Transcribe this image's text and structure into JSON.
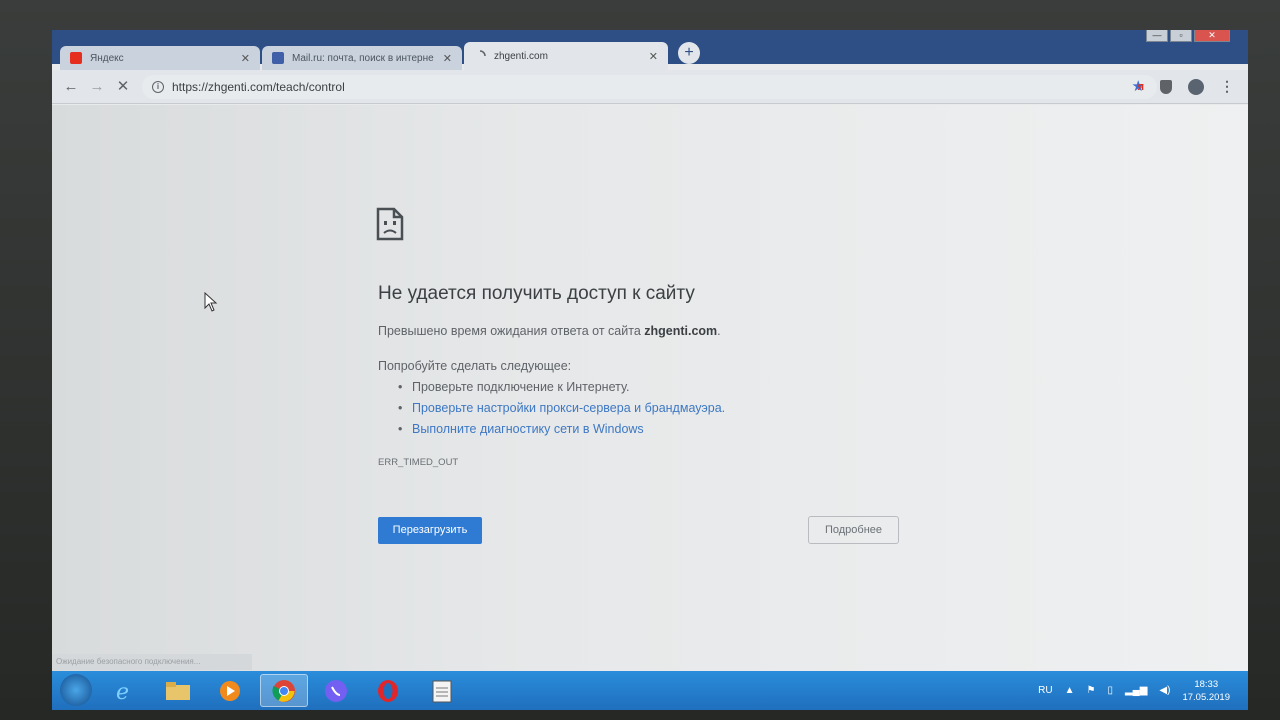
{
  "tabs": [
    {
      "title": "Яндекс",
      "favicon_color": "#e52e1e",
      "close": "✕"
    },
    {
      "title": "Mail.ru: почта, поиск в интерне",
      "favicon_color": "#3f5fa8",
      "close": "✕"
    },
    {
      "title": "zhgenti.com",
      "favicon_icon": "loading-spinner-icon",
      "close": "✕"
    }
  ],
  "new_tab": "+",
  "window_controls": {
    "minimize": "—",
    "maximize": "▫",
    "close": "✕"
  },
  "nav": {
    "back": "←",
    "forward": "→",
    "stop": "✕"
  },
  "address_bar": {
    "url": "https://zhgenti.com/teach/control",
    "info": "i",
    "bookmark": "★"
  },
  "toolbar_icons": {
    "yandex": "я",
    "menu": "⋮"
  },
  "error": {
    "title": "Не удается получить доступ к сайту",
    "desc_prefix": "Превышено время ожидания ответа от сайта ",
    "site": "zhgenti.com",
    "desc_suffix": ".",
    "try_label": "Попробуйте сделать следующее:",
    "suggestions": [
      "Проверьте подключение к Интернету.",
      "Проверьте настройки прокси-сервера и брандмауэра.",
      "Выполните диагностику сети в Windows"
    ],
    "code": "ERR_TIMED_OUT",
    "reload_button": "Перезагрузить",
    "details_button": "Подробнее"
  },
  "status_bar": "Ожидание безопасного подключения...",
  "taskbar": {
    "apps": [
      "internet-explorer",
      "file-explorer",
      "media-player",
      "chrome",
      "viber",
      "opera",
      "notepad"
    ],
    "language": "RU",
    "time": "18:33",
    "date": "17.05.2019"
  },
  "colors": {
    "accent": "#2f7bd4",
    "link": "#3e78c4",
    "taskbar": "#1f6fbd"
  }
}
